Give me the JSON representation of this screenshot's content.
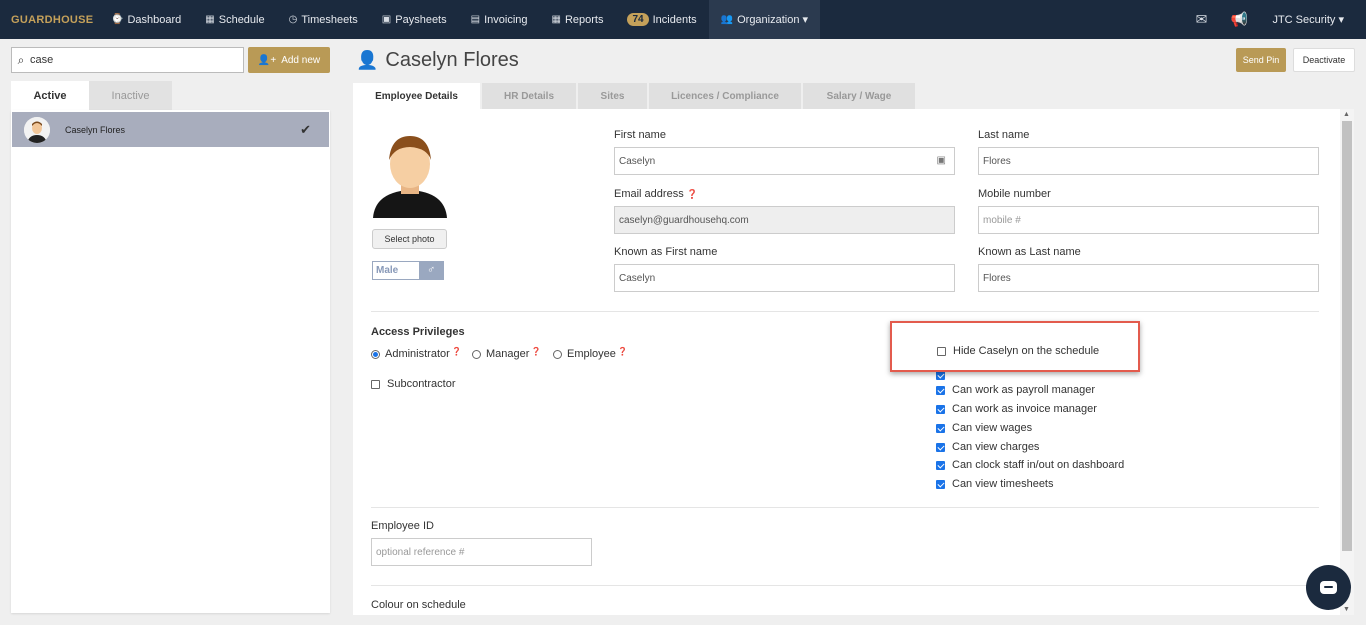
{
  "nav": {
    "brand": "GUARDHOUSE",
    "items": [
      {
        "label": "Dashboard",
        "icon": "⌚"
      },
      {
        "label": "Schedule",
        "icon": "▦"
      },
      {
        "label": "Timesheets",
        "icon": "◷"
      },
      {
        "label": "Paysheets",
        "icon": "▣"
      },
      {
        "label": "Invoicing",
        "icon": "▤"
      },
      {
        "label": "Reports",
        "icon": "▦"
      },
      {
        "label": "Incidents",
        "badge": "74"
      },
      {
        "label": "Organization ▾",
        "icon": "👥"
      }
    ],
    "company": "JTC Security ▾"
  },
  "left": {
    "search_value": "case",
    "add_new": "Add new",
    "tabs": [
      "Active",
      "Inactive"
    ],
    "employee_name": "Caselyn Flores"
  },
  "header": {
    "name": "Caselyn Flores",
    "send_pin": "Send Pin",
    "deactivate": "Deactivate"
  },
  "tabs": [
    "Employee Details",
    "HR Details",
    "Sites",
    "Licences / Compliance",
    "Salary / Wage"
  ],
  "profile": {
    "select_photo": "Select photo",
    "gender": "Male"
  },
  "form": {
    "first_name_label": "First name",
    "first_name": "Caselyn",
    "last_name_label": "Last name",
    "last_name": "Flores",
    "email_label": "Email address",
    "email": "caselyn@guardhousehq.com",
    "mobile_label": "Mobile number",
    "mobile_placeholder": "mobile #",
    "known_first_label": "Known as First name",
    "known_first": "Caselyn",
    "known_last_label": "Known as Last name",
    "known_last": "Flores",
    "employee_id_label": "Employee ID",
    "employee_id_placeholder": "optional reference #",
    "colour_label": "Colour on schedule"
  },
  "access": {
    "title": "Access Privileges",
    "roles": [
      "Administrator",
      "Manager",
      "Employee"
    ],
    "selected": "Administrator",
    "subcontractor": "Subcontractor"
  },
  "permissions": {
    "hide": {
      "label": "Hide Caselyn on the schedule",
      "checked": false
    },
    "items": [
      {
        "label": "Can work as payroll manager",
        "checked": true
      },
      {
        "label": "Can work as invoice manager",
        "checked": true
      },
      {
        "label": "Can view wages",
        "checked": true
      },
      {
        "label": "Can view charges",
        "checked": true
      },
      {
        "label": "Can clock staff in/out on dashboard",
        "checked": true
      },
      {
        "label": "Can view timesheets",
        "checked": true
      }
    ]
  },
  "colors": {
    "nav": "#1b2a3e",
    "accent": "#b99a56",
    "highlight": "#e35b4d"
  }
}
